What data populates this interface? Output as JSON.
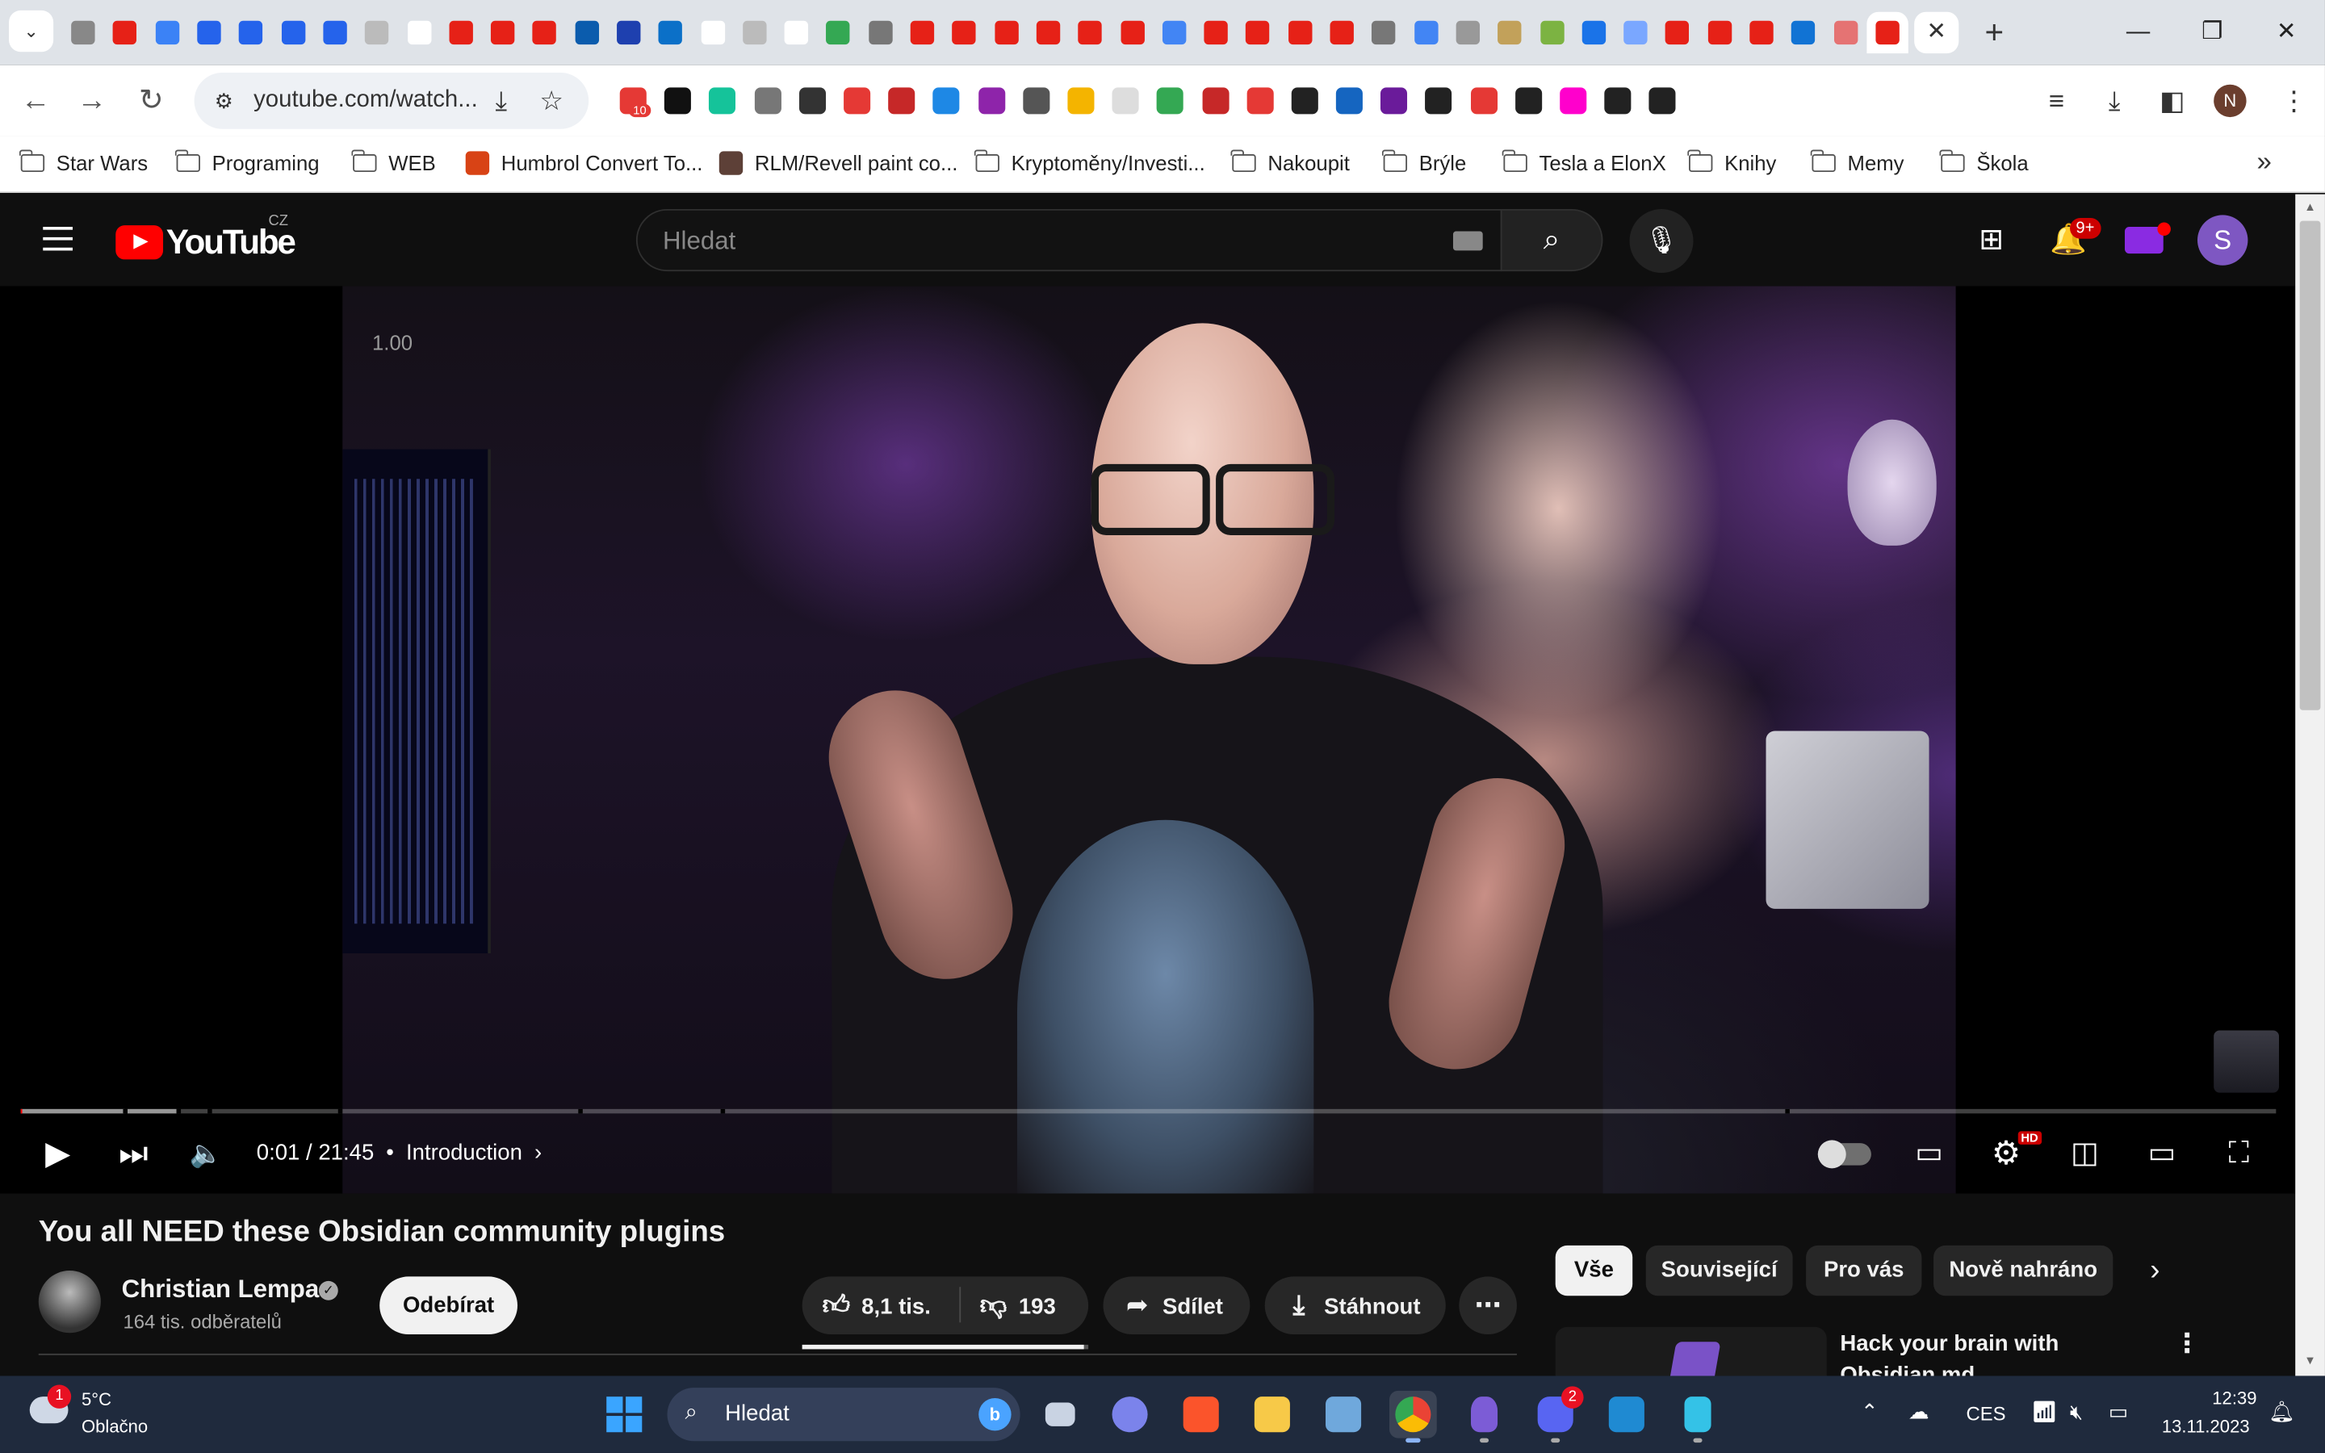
{
  "browser": {
    "tab_favicon_colors": [
      "#888888",
      "#e62117",
      "#3b82f6",
      "#2563eb",
      "#2563eb",
      "#2563eb",
      "#2563eb",
      "#bbbbbb",
      "#ffffff",
      "#e62117",
      "#e62117",
      "#e62117",
      "#0b5cad",
      "#1e40af",
      "#0b70c8",
      "#ffffff",
      "#bbbbbb",
      "#ffffff",
      "#34a853",
      "#777777",
      "#e62117",
      "#e62117",
      "#e62117",
      "#e62117",
      "#e62117",
      "#e62117",
      "#4285f4",
      "#e62117",
      "#e62117",
      "#e62117",
      "#e62117",
      "#777777",
      "#4285f4",
      "#999999",
      "#c2a15a",
      "#7cb342",
      "#1a73e8",
      "#7aa7ff",
      "#e62117",
      "#e62117",
      "#e62117",
      "#1173d4",
      "#e57373",
      "#e62117"
    ],
    "address": "youtube.com/watch...",
    "extension_colors": [
      "#e53935",
      "#111111",
      "#15c39a",
      "#777777",
      "#333333",
      "#e53935",
      "#c62828",
      "#1e88e5",
      "#8e24aa",
      "#555555",
      "#f4b400",
      "#dddddd",
      "#34a853",
      "#c62828",
      "#e53935",
      "#222222",
      "#1565c0",
      "#6a1b9a",
      "#222222",
      "#e53935",
      "#222222",
      "#ff00cc",
      "#222222",
      "#222222"
    ],
    "extension_badge": "10",
    "profile_initial": "N",
    "bookmarks": [
      {
        "label": "Star Wars",
        "type": "folder"
      },
      {
        "label": "Programing",
        "type": "folder"
      },
      {
        "label": "WEB",
        "type": "folder"
      },
      {
        "label": "Humbrol Convert To...",
        "type": "site",
        "color": "#d84315"
      },
      {
        "label": "RLM/Revell paint co...",
        "type": "site",
        "color": "#5d4037"
      },
      {
        "label": "Kryptoměny/Investi...",
        "type": "folder"
      },
      {
        "label": "Nakoupit",
        "type": "folder"
      },
      {
        "label": "Brýle",
        "type": "folder"
      },
      {
        "label": "Tesla a ElonX",
        "type": "folder"
      },
      {
        "label": "Knihy",
        "type": "folder"
      },
      {
        "label": "Memy",
        "type": "folder"
      },
      {
        "label": "Škola",
        "type": "folder"
      }
    ]
  },
  "youtube": {
    "logo_text": "YouTube",
    "region": "CZ",
    "search_placeholder": "Hledat",
    "notification_count": "9+",
    "avatar_initial": "S",
    "player": {
      "speed_overlay": "1.00",
      "time": "0:01 / 21:45",
      "chapter": "Introduction",
      "progress_fraction": 0.0008,
      "quality_badge": "HD"
    },
    "video": {
      "title": "You all NEED these Obsidian community plugins",
      "channel": "Christian Lempa",
      "subscribers": "164 tis. odběratelů",
      "subscribe_label": "Odebírat",
      "likes": "8,1 tis.",
      "dislikes": "193",
      "share_label": "Sdílet",
      "download_label": "Stáhnout"
    },
    "chips": [
      {
        "label": "Vše",
        "active": true
      },
      {
        "label": "Související",
        "active": false
      },
      {
        "label": "Pro vás",
        "active": false
      },
      {
        "label": "Nově nahráno",
        "active": false
      }
    ],
    "recommendation": {
      "title": "Hack your brain with Obsidian.md"
    }
  },
  "taskbar": {
    "weather_alert": "1",
    "temperature": "5°C",
    "weather": "Oblačno",
    "search_placeholder": "Hledat",
    "discord_badge": "2",
    "language": "CES",
    "time": "12:39",
    "date": "13.11.2023"
  }
}
